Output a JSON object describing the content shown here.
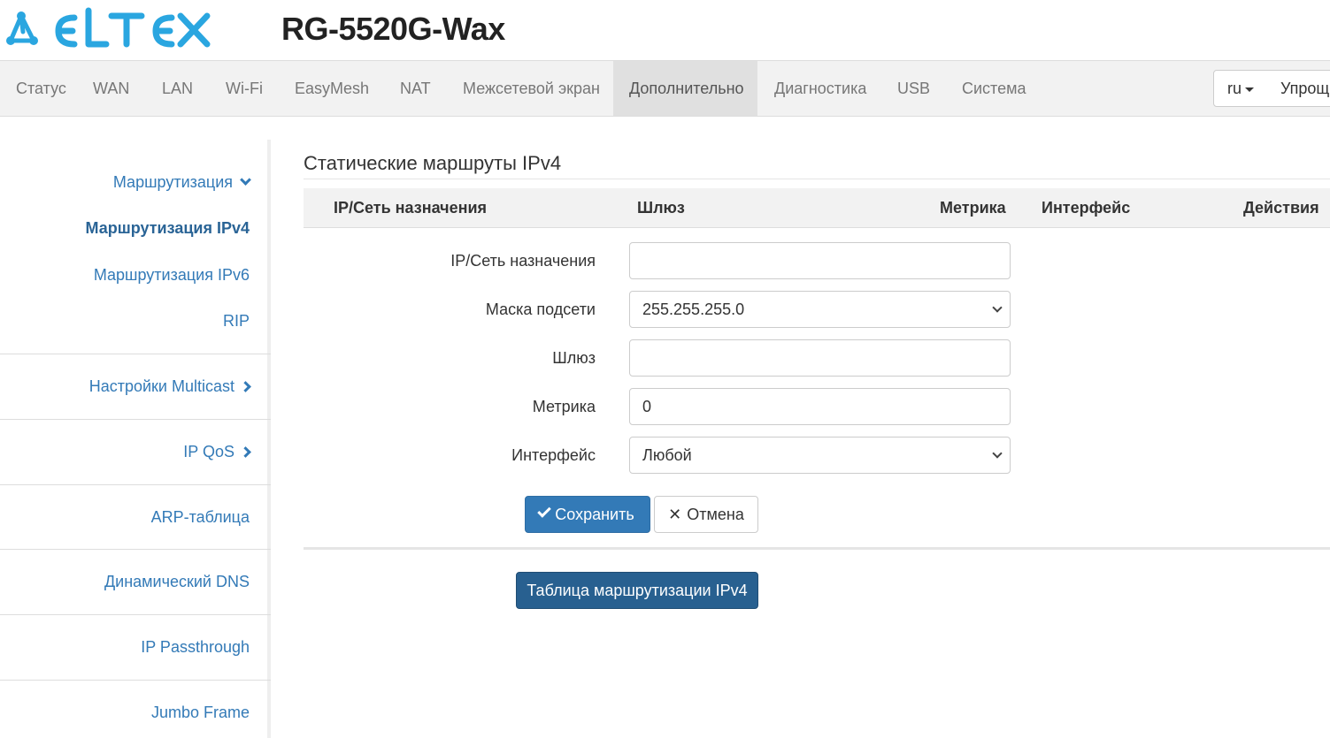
{
  "header": {
    "logo_text": "ELTEX",
    "device_title": "RG-5520G-Wax"
  },
  "nav": {
    "items": [
      {
        "label": "Статус"
      },
      {
        "label": "WAN"
      },
      {
        "label": "LAN"
      },
      {
        "label": "Wi-Fi"
      },
      {
        "label": "EasyMesh"
      },
      {
        "label": "NAT"
      },
      {
        "label": "Межсетевой экран"
      },
      {
        "label": "Дополнительно",
        "active": true
      },
      {
        "label": "Диагностика"
      },
      {
        "label": "USB"
      },
      {
        "label": "Система"
      }
    ],
    "language": "ru",
    "mode": "Упрощ"
  },
  "sidebar": {
    "routing": "Маршрутизация",
    "routing_ipv4": "Маршрутизация IPv4",
    "routing_ipv6": "Маршрутизация IPv6",
    "rip": "RIP",
    "multicast": "Настройки Multicast",
    "ip_qos": "IP QoS",
    "arp_table": "ARP-таблица",
    "dynamic_dns": "Динамический DNS",
    "ip_passthrough": "IP Passthrough",
    "jumbo_frame": "Jumbo Frame"
  },
  "main": {
    "title": "Статические маршруты IPv4",
    "table_headers": {
      "destination": "IP/Сеть назначения",
      "gateway": "Шлюз",
      "metric": "Метрика",
      "interface": "Интерфейс",
      "actions": "Действия"
    },
    "form": {
      "destination_label": "IP/Сеть назначения",
      "destination_value": "",
      "mask_label": "Маска подсети",
      "mask_value": "255.255.255.0",
      "gateway_label": "Шлюз",
      "gateway_value": "",
      "metric_label": "Метрика",
      "metric_value": "0",
      "interface_label": "Интерфейс",
      "interface_value": "Любой"
    },
    "save_button": "Сохранить",
    "cancel_button": "Отмена",
    "routing_table_button": "Таблица маршрутизации IPv4"
  },
  "colors": {
    "primary": "#337ab7",
    "primary_dark": "#286090",
    "brand": "#2aa6e0"
  }
}
